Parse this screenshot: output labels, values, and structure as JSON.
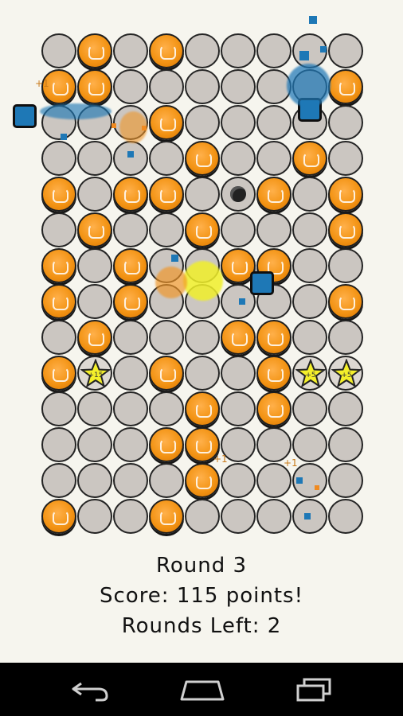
{
  "status": {
    "round": "Round 3",
    "score": "Score: 115 points!",
    "rounds_left": "Rounds Left: 2"
  },
  "board": {
    "rows": 14,
    "cols": 9,
    "cells": [
      "ngnngnnnnn",
      "googgggggo"
    ]
  },
  "grid": [
    "gogoggggg",
    "oogggggggo",
    "gggggo",
    "ggggoggog",
    "ogoogbogo",
    "ggoggogo",
    "ogoggogo",
    "ogogggoo",
    "gogggggg",
    "oSgogoSSo",
    "ggggogog",
    "gggoogggg",
    "ggggogggg",
    "oggoggggg"
  ],
  "stars": [
    "+15",
    "+5",
    "+5"
  ],
  "floating_points": [
    "+1",
    "+1",
    "+1"
  ],
  "navbar": {
    "back_icon": "back-arrow-icon",
    "home_icon": "home-icon",
    "recents_icon": "recent-apps-icon"
  },
  "colors": {
    "empty": "#cbc6c1",
    "orange": "#f39415",
    "blue": "#1e78b6",
    "star": "#f4ef2a"
  }
}
